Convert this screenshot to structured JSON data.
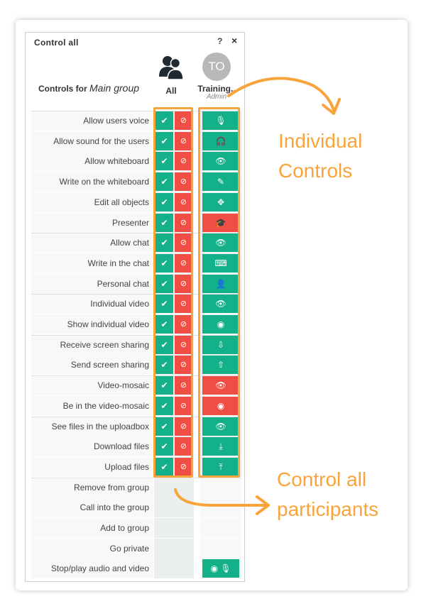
{
  "panel": {
    "title": "Control all",
    "help": "?",
    "close": "×",
    "controls_for_prefix": "Controls for ",
    "group_name": "Main group",
    "all_label": "All",
    "user_initials": "TO",
    "user_name": "Training..",
    "user_role": "Admin"
  },
  "rows": [
    {
      "label": "Allow users voice",
      "ind": "mic",
      "ind_state": "green"
    },
    {
      "label": "Allow sound for the users",
      "ind": "headphones",
      "ind_state": "green"
    },
    {
      "label": "Allow whiteboard",
      "ind": "eye",
      "ind_state": "green"
    },
    {
      "label": "Write on the whiteboard",
      "ind": "pen",
      "ind_state": "green"
    },
    {
      "label": "Edit all objects",
      "ind": "move",
      "ind_state": "green"
    },
    {
      "label": "Presenter",
      "ind": "cap",
      "ind_state": "red"
    },
    {
      "label": "Allow chat",
      "ind": "eye",
      "ind_state": "green"
    },
    {
      "label": "Write in the chat",
      "ind": "keyboard",
      "ind_state": "green"
    },
    {
      "label": "Personal chat",
      "ind": "person",
      "ind_state": "green"
    },
    {
      "label": "Individual video",
      "ind": "eye",
      "ind_state": "green"
    },
    {
      "label": "Show individual video",
      "ind": "webcam",
      "ind_state": "green"
    },
    {
      "label": "Receive screen sharing",
      "ind": "screen-down",
      "ind_state": "green"
    },
    {
      "label": "Send screen sharing",
      "ind": "screen-up",
      "ind_state": "green"
    },
    {
      "label": "Video-mosaic",
      "ind": "eye",
      "ind_state": "red"
    },
    {
      "label": "Be in the video-mosaic",
      "ind": "webcam",
      "ind_state": "red"
    },
    {
      "label": "See files in the uploadbox",
      "ind": "eye",
      "ind_state": "green"
    },
    {
      "label": "Download files",
      "ind": "download",
      "ind_state": "green"
    },
    {
      "label": "Upload files",
      "ind": "upload",
      "ind_state": "green"
    }
  ],
  "extra_rows": [
    {
      "label": "Remove from group"
    },
    {
      "label": "Call into the group"
    },
    {
      "label": "Add to group"
    },
    {
      "label": "Go private"
    },
    {
      "label": "Stop/play audio and video"
    }
  ],
  "callouts": {
    "individual": [
      "Individual",
      "Controls"
    ],
    "all": [
      "Control all",
      "participants"
    ]
  },
  "colors": {
    "green": "#14b08a",
    "red": "#f04e45",
    "orange": "#f9a43b"
  }
}
